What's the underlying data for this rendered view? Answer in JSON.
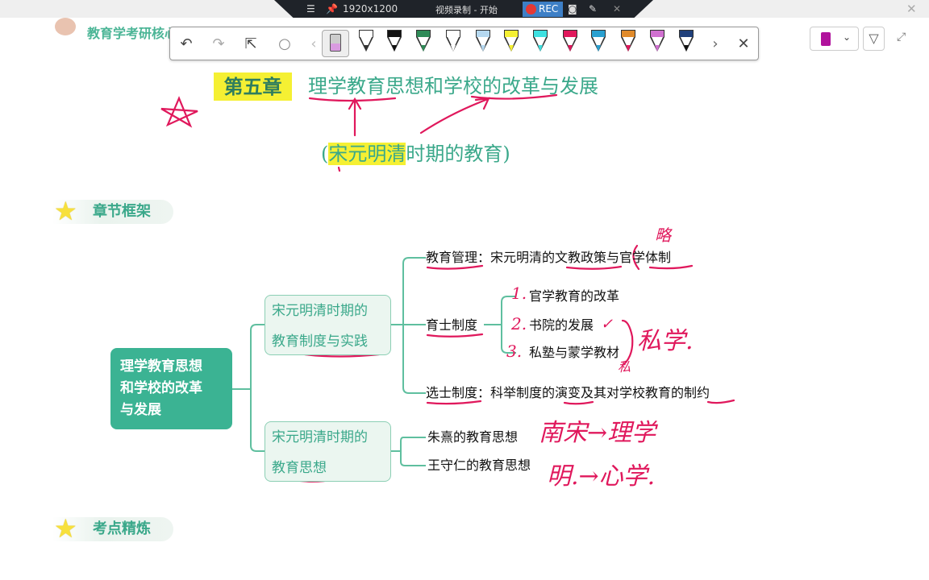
{
  "recorder": {
    "resolution": "1920x1200",
    "status": "视频录制 - 开始",
    "rec_label": "REC"
  },
  "app": {
    "logo_text": "教育学考研核心"
  },
  "toolbar": {
    "undo": "↶",
    "redo": "↷",
    "select": "⇱",
    "lasso": "○",
    "prev": "‹",
    "next": "›",
    "close": "✕",
    "pens": [
      {
        "cap": "#ffffff",
        "tip": "#333333"
      },
      {
        "cap": "#111111",
        "tip": "#111111"
      },
      {
        "cap": "#2e8b57",
        "tip": "#2e8b57"
      },
      {
        "cap": "#ffffff",
        "tip": "#ffffff"
      },
      {
        "cap": "#b5d8f0",
        "tip": "#b5d8f0"
      },
      {
        "cap": "#f5f033",
        "tip": "#f5f033"
      },
      {
        "cap": "#3ee0e0",
        "tip": "#3ee0e0"
      },
      {
        "cap": "#e0185c",
        "tip": "#e0185c"
      },
      {
        "cap": "#2aa0d0",
        "tip": "#2aa0d0"
      },
      {
        "cap": "#e08a2a",
        "tip": "#e0185c"
      },
      {
        "cap": "#d070d0",
        "tip": "#d070d0"
      },
      {
        "cap": "#1f3f7a",
        "tip": "#111111"
      }
    ]
  },
  "colors": {
    "accent": "#3aa88a",
    "ink": "#e0185c",
    "highlight": "#f5f033"
  },
  "slide": {
    "chapter": "第五章",
    "title": "理学教育思想和学校的改革与发展",
    "subtitle_open": "(",
    "subtitle_hl": "宋元明清",
    "subtitle_rest": "时期的教育)",
    "section1": "章节框架",
    "section2": "考点精炼",
    "center_node": [
      "理学教育思想",
      "和学校的改革",
      "与发展"
    ],
    "branch1": [
      "宋元明清时期的",
      "教育制度与实践"
    ],
    "branch2": [
      "宋元明清时期的",
      "教育思想"
    ],
    "items": {
      "mgmt": "教育管理：宋元明清的文教政策与官学体制",
      "yushi": "育士制度",
      "sub": [
        "官学教育的改革",
        "书院的发展",
        "私塾与蒙学教材"
      ],
      "xuanshi": "选士制度：科举制度的演变及其对学校教育的制约",
      "zhuxi": "朱熹的教育思想",
      "wang": "王守仁的教育思想"
    },
    "handwriting": {
      "lue": "略",
      "nums": [
        "1.",
        "2.",
        "3."
      ],
      "sixue": "私学.",
      "si": "私",
      "check": "✓",
      "nansong": "南宋→理学",
      "ming": "明.→心学."
    }
  }
}
